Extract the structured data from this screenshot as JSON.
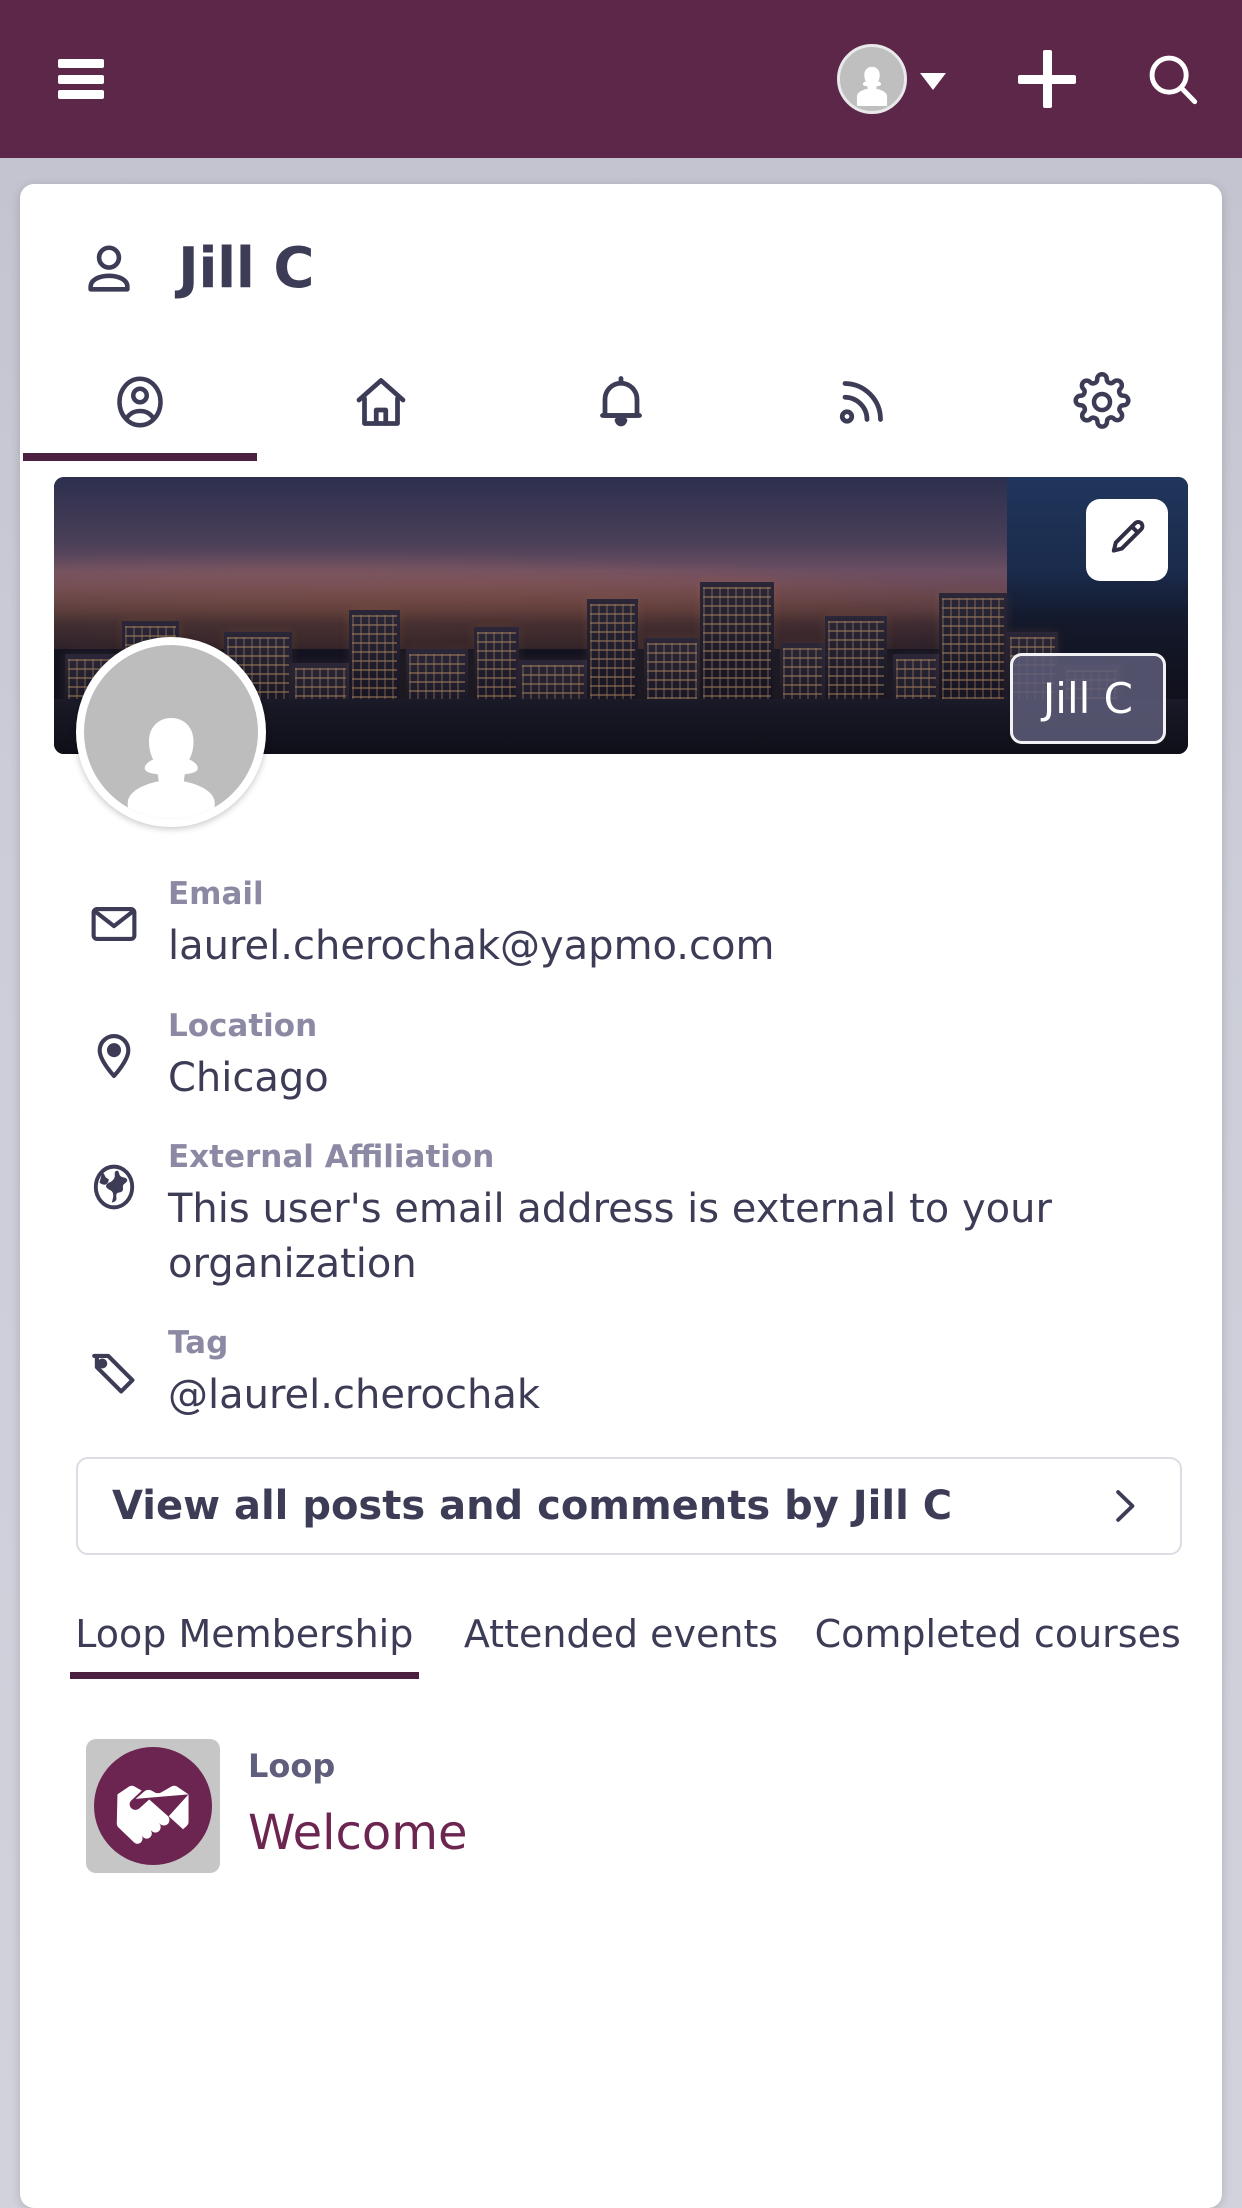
{
  "colors": {
    "brand_purple": "#5c2748",
    "accent_underline": "#4c2040",
    "text_dark": "#3d3c57",
    "label_muted": "#8b89a3",
    "loop_purple": "#6c2550"
  },
  "appbar": {
    "menu_label": "menu",
    "avatar_label": "account",
    "caret_label": "account menu",
    "add_label": "add",
    "search_label": "search"
  },
  "page": {
    "title": "Jill C"
  },
  "icon_tabs": [
    {
      "name": "profile",
      "active": true
    },
    {
      "name": "home",
      "active": false
    },
    {
      "name": "notifications",
      "active": false
    },
    {
      "name": "feed",
      "active": false
    },
    {
      "name": "settings",
      "active": false
    }
  ],
  "banner": {
    "edit_label": "Edit cover photo",
    "name_badge": "Jill C",
    "avatar_label": "Jill C profile photo"
  },
  "info_fields": [
    {
      "icon": "envelope-icon",
      "label": "Email",
      "value": "laurel.cherochak@yapmo.com"
    },
    {
      "icon": "location-pin-icon",
      "label": "Location",
      "value": "Chicago"
    },
    {
      "icon": "globe-icon",
      "label": "External Affiliation",
      "value": "This user's email address is external to your organization"
    },
    {
      "icon": "tag-icon",
      "label": "Tag",
      "value": "@laurel.cherochak"
    }
  ],
  "view_all": {
    "label": "View all posts and comments by Jill C",
    "chevron": "chevron-right-icon"
  },
  "bottom_tabs": [
    {
      "label": "Loop Membership",
      "active": true
    },
    {
      "label": "Attended events",
      "active": false
    },
    {
      "label": "Completed courses",
      "active": false
    }
  ],
  "loop_items": [
    {
      "kind": "Loop",
      "name": "Welcome",
      "thumb_icon": "handshake-icon"
    }
  ]
}
